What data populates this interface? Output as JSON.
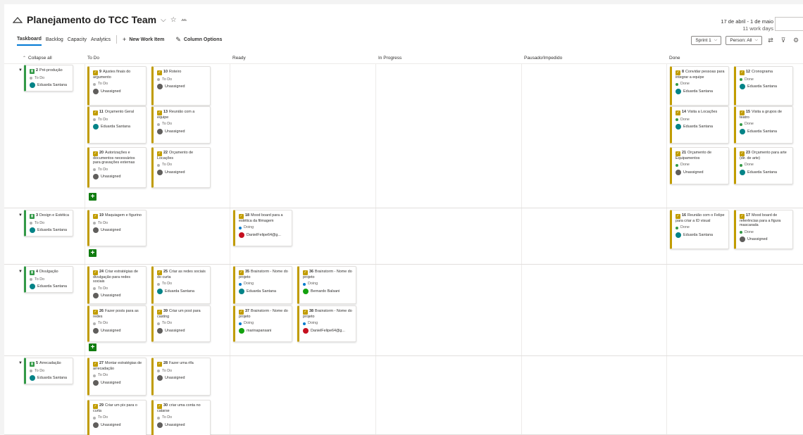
{
  "header": {
    "title": "Planejamento do TCC Team",
    "title_chevron": "⌵",
    "favorite_icon": "☆",
    "team_icon": "ꕀ",
    "date_range": "17 de abril - 1 de maio",
    "work_days": "11 work days"
  },
  "tabs": {
    "taskboard": "Taskboard",
    "backlog": "Backlog",
    "capacity": "Capacity",
    "analytics": "Analytics",
    "new_work_item": "New Work Item",
    "column_options": "Column Options"
  },
  "controls": {
    "sprint": "Sprint 1",
    "person": "Person: All"
  },
  "columns": {
    "collapse_all": "Collapse all",
    "todo": "To Do",
    "ready": "Ready",
    "in_progress": "In Progress",
    "paused": "Pausado/Impedido",
    "done": "Done"
  },
  "lanes": [
    {
      "parent": {
        "id": "2",
        "title": "Pré-produção",
        "state": "To Do",
        "assignee": "Eduarda Santana"
      },
      "cards": [
        {
          "id": "9",
          "title": "Ajustes finais do argumento",
          "state": "To Do",
          "assignee": "Unassigned"
        },
        {
          "id": "10",
          "title": "Roteiro",
          "state": "To Do",
          "assignee": "Unassigned"
        },
        {
          "id": "11",
          "title": "Orçamento Geral",
          "state": "To Do",
          "assignee": "Eduarda Santana"
        },
        {
          "id": "13",
          "title": "Reunião com a equipe",
          "state": "To Do",
          "assignee": "Unassigned"
        },
        {
          "id": "20",
          "title": "Autorizações e documentos necessários para gravações externas",
          "state": "To Do",
          "assignee": "Unassigned"
        },
        {
          "id": "22",
          "title": "Orçamento de Locações",
          "state": "To Do",
          "assignee": "Unassigned"
        },
        {
          "id": "8",
          "title": "Convidar pessoas para integrar a equipe",
          "state": "Done",
          "assignee": "Eduarda Santana"
        },
        {
          "id": "12",
          "title": "Cronograma",
          "state": "Done",
          "assignee": "Eduarda Santana"
        },
        {
          "id": "14",
          "title": "Visita a Locações",
          "state": "Done",
          "assignee": "Eduarda Santana"
        },
        {
          "id": "15",
          "title": "Visita a grupos de teatro",
          "state": "Done",
          "assignee": "Eduarda Santana"
        },
        {
          "id": "21",
          "title": "Orçamento de Equipamentos",
          "state": "Done",
          "assignee": "Unassigned"
        },
        {
          "id": "23",
          "title": "Orçamento para arte (dir. de arte)",
          "state": "Done",
          "assignee": "Eduarda Santana"
        }
      ]
    },
    {
      "parent": {
        "id": "3",
        "title": "Design e Estética",
        "state": "To Do",
        "assignee": "Eduarda Santana"
      },
      "cards": [
        {
          "id": "19",
          "title": "Maquiagem e figurino",
          "state": "To Do",
          "assignee": "Unassigned"
        },
        {
          "id": "18",
          "title": "Mood board para a estética da filmagem",
          "state": "Doing",
          "assignee": "DanielFelipe64@g..."
        },
        {
          "id": "16",
          "title": "Reunião com o Felipe para criar a ID visual",
          "state": "Done",
          "assignee": "Eduarda Santana"
        },
        {
          "id": "17",
          "title": "Mood board de referências para a figura mascarada",
          "state": "Done",
          "assignee": "Unassigned"
        }
      ]
    },
    {
      "parent": {
        "id": "4",
        "title": "Divulgação",
        "state": "To Do",
        "assignee": "Eduarda Santana"
      },
      "cards": [
        {
          "id": "24",
          "title": "Criar estratégias de divulgação para redes sociais",
          "state": "To Do",
          "assignee": "Unassigned"
        },
        {
          "id": "25",
          "title": "Criar as redes sociais do curta",
          "state": "To Do",
          "assignee": "Eduarda Santana"
        },
        {
          "id": "26",
          "title": "Fazer posts para as redes",
          "state": "To Do",
          "assignee": "Unassigned"
        },
        {
          "id": "39",
          "title": "Criar um post para casting",
          "state": "To Do",
          "assignee": "Unassigned"
        },
        {
          "id": "35",
          "title": "Brainstorm - Nome do projeto",
          "state": "Doing",
          "assignee": "Eduarda Santana"
        },
        {
          "id": "36",
          "title": "Brainstorm - Nome do projeto",
          "state": "Doing",
          "assignee": "Bernardo Balsani"
        },
        {
          "id": "37",
          "title": "Brainstorm - Nome do projeto",
          "state": "Doing",
          "assignee": "marinapansani"
        },
        {
          "id": "38",
          "title": "Brainstorm - Nome do projeto",
          "state": "Doing",
          "assignee": "DanielFelipe64@g..."
        }
      ]
    },
    {
      "parent": {
        "id": "5",
        "title": "Arrecadação",
        "state": "To Do",
        "assignee": "Eduarda Santana"
      },
      "cards": [
        {
          "id": "27",
          "title": "Montar estratégias de arrecadação",
          "state": "To Do",
          "assignee": "Unassigned"
        },
        {
          "id": "28",
          "title": "Fazer uma rifa",
          "state": "To Do",
          "assignee": "Unassigned"
        },
        {
          "id": "29",
          "title": "Criar um pix para o curta",
          "state": "To Do",
          "assignee": "Unassigned"
        },
        {
          "id": "30",
          "title": "criar uma conta no catarse",
          "state": "To Do",
          "assignee": "Unassigned"
        }
      ]
    }
  ],
  "add_label": "+",
  "colors": {
    "task": "#c19c00",
    "epic": "#339947",
    "accent": "#0078d4",
    "add": "#107c10"
  }
}
